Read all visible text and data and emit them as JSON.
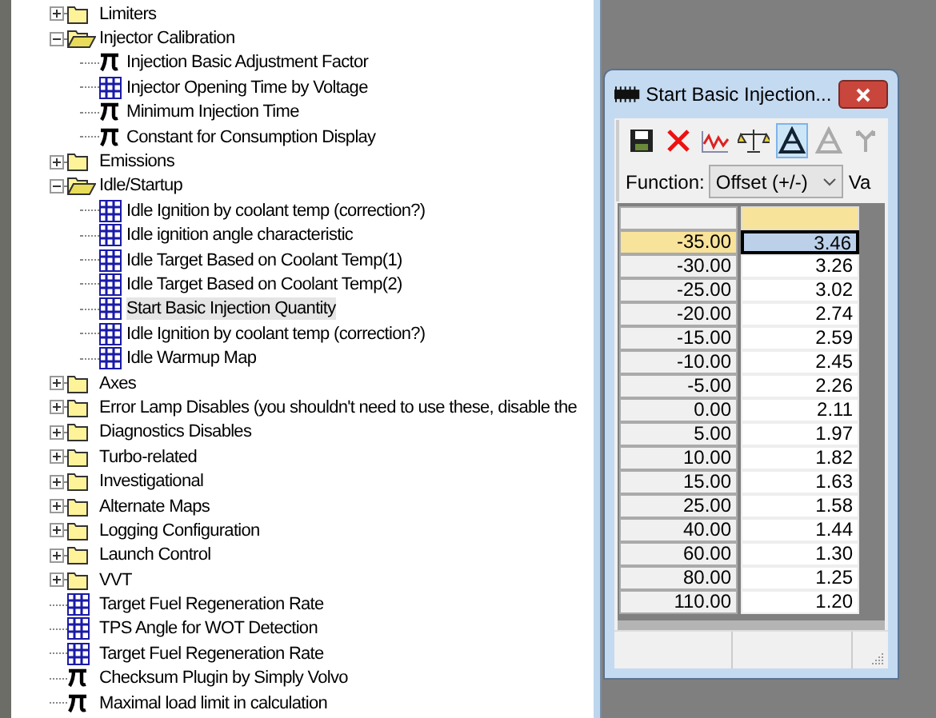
{
  "tree": [
    {
      "kind": "folder",
      "label": "Limiters",
      "expanded": false,
      "selected": false
    },
    {
      "kind": "folder",
      "label": "Injector Calibration",
      "expanded": true,
      "selected": false,
      "children": [
        {
          "kind": "constant",
          "label": "Injection Basic Adjustment Factor",
          "selected": false
        },
        {
          "kind": "map",
          "label": "Injector Opening Time by Voltage",
          "selected": false
        },
        {
          "kind": "constant",
          "label": "Minimum Injection Time",
          "selected": false
        },
        {
          "kind": "constant",
          "label": "Constant for Consumption Display",
          "selected": false
        }
      ]
    },
    {
      "kind": "folder",
      "label": "Emissions",
      "expanded": false,
      "selected": false
    },
    {
      "kind": "folder",
      "label": "Idle/Startup",
      "expanded": true,
      "selected": false,
      "children": [
        {
          "kind": "map",
          "label": "Idle Ignition by coolant temp (correction?)",
          "selected": false
        },
        {
          "kind": "map",
          "label": "Idle ignition angle characteristic",
          "selected": false
        },
        {
          "kind": "map",
          "label": "Idle Target Based on Coolant Temp(1)",
          "selected": false
        },
        {
          "kind": "map",
          "label": "Idle Target Based on Coolant Temp(2)",
          "selected": false
        },
        {
          "kind": "map",
          "label": "Start Basic Injection Quantity",
          "selected": true
        },
        {
          "kind": "map",
          "label": "Idle Ignition by coolant temp (correction?)",
          "selected": false
        },
        {
          "kind": "map",
          "label": "Idle Warmup Map",
          "selected": false
        }
      ]
    },
    {
      "kind": "folder",
      "label": "Axes",
      "expanded": false,
      "selected": false
    },
    {
      "kind": "folder",
      "label": "Error Lamp Disables (you shouldn't need to use these, disable the",
      "expanded": false,
      "selected": false
    },
    {
      "kind": "folder",
      "label": "Diagnostics Disables",
      "expanded": false,
      "selected": false
    },
    {
      "kind": "folder",
      "label": "Turbo-related",
      "expanded": false,
      "selected": false
    },
    {
      "kind": "folder",
      "label": "Investigational",
      "expanded": false,
      "selected": false
    },
    {
      "kind": "folder",
      "label": "Alternate Maps",
      "expanded": false,
      "selected": false
    },
    {
      "kind": "folder",
      "label": "Logging Configuration",
      "expanded": false,
      "selected": false
    },
    {
      "kind": "folder",
      "label": "Launch Control",
      "expanded": false,
      "selected": false
    },
    {
      "kind": "folder",
      "label": "VVT",
      "expanded": false,
      "selected": false
    },
    {
      "kind": "map",
      "label": "Target Fuel Regeneration Rate",
      "selected": false
    },
    {
      "kind": "map",
      "label": "TPS Angle for WOT Detection",
      "selected": false
    },
    {
      "kind": "map",
      "label": "Target Fuel Regeneration Rate",
      "selected": false
    },
    {
      "kind": "constant",
      "label": "Checksum Plugin by Simply Volvo",
      "selected": false
    },
    {
      "kind": "constant",
      "label": "Maximal load limit in calculation",
      "selected": false
    }
  ],
  "editor": {
    "title": "Start Basic Injection...",
    "toolbar": [
      {
        "kind": "save",
        "pressed": false,
        "disabled": false
      },
      {
        "kind": "delete",
        "pressed": false,
        "disabled": false
      },
      {
        "kind": "graph",
        "pressed": false,
        "disabled": false
      },
      {
        "kind": "scale",
        "pressed": false,
        "disabled": false
      },
      {
        "kind": "delta",
        "pressed": true,
        "disabled": false
      },
      {
        "kind": "delta",
        "pressed": false,
        "disabled": true
      },
      {
        "kind": "fork",
        "pressed": false,
        "disabled": true
      }
    ],
    "function_label": "Function:",
    "function_value": "Offset (+/-)",
    "column_4_label": "Va",
    "rows": [
      {
        "axis": "-35.00",
        "value": "3.46",
        "selected": true
      },
      {
        "axis": "-30.00",
        "value": "3.26",
        "selected": false
      },
      {
        "axis": "-25.00",
        "value": "3.02",
        "selected": false
      },
      {
        "axis": "-20.00",
        "value": "2.74",
        "selected": false
      },
      {
        "axis": "-15.00",
        "value": "2.59",
        "selected": false
      },
      {
        "axis": "-10.00",
        "value": "2.45",
        "selected": false
      },
      {
        "axis": "-5.00",
        "value": "2.26",
        "selected": false
      },
      {
        "axis": "0.00",
        "value": "2.11",
        "selected": false
      },
      {
        "axis": "5.00",
        "value": "1.97",
        "selected": false
      },
      {
        "axis": "10.00",
        "value": "1.82",
        "selected": false
      },
      {
        "axis": "15.00",
        "value": "1.63",
        "selected": false
      },
      {
        "axis": "25.00",
        "value": "1.58",
        "selected": false
      },
      {
        "axis": "40.00",
        "value": "1.44",
        "selected": false
      },
      {
        "axis": "60.00",
        "value": "1.30",
        "selected": false
      },
      {
        "axis": "80.00",
        "value": "1.25",
        "selected": false
      },
      {
        "axis": "110.00",
        "value": "1.20",
        "selected": false
      }
    ]
  }
}
